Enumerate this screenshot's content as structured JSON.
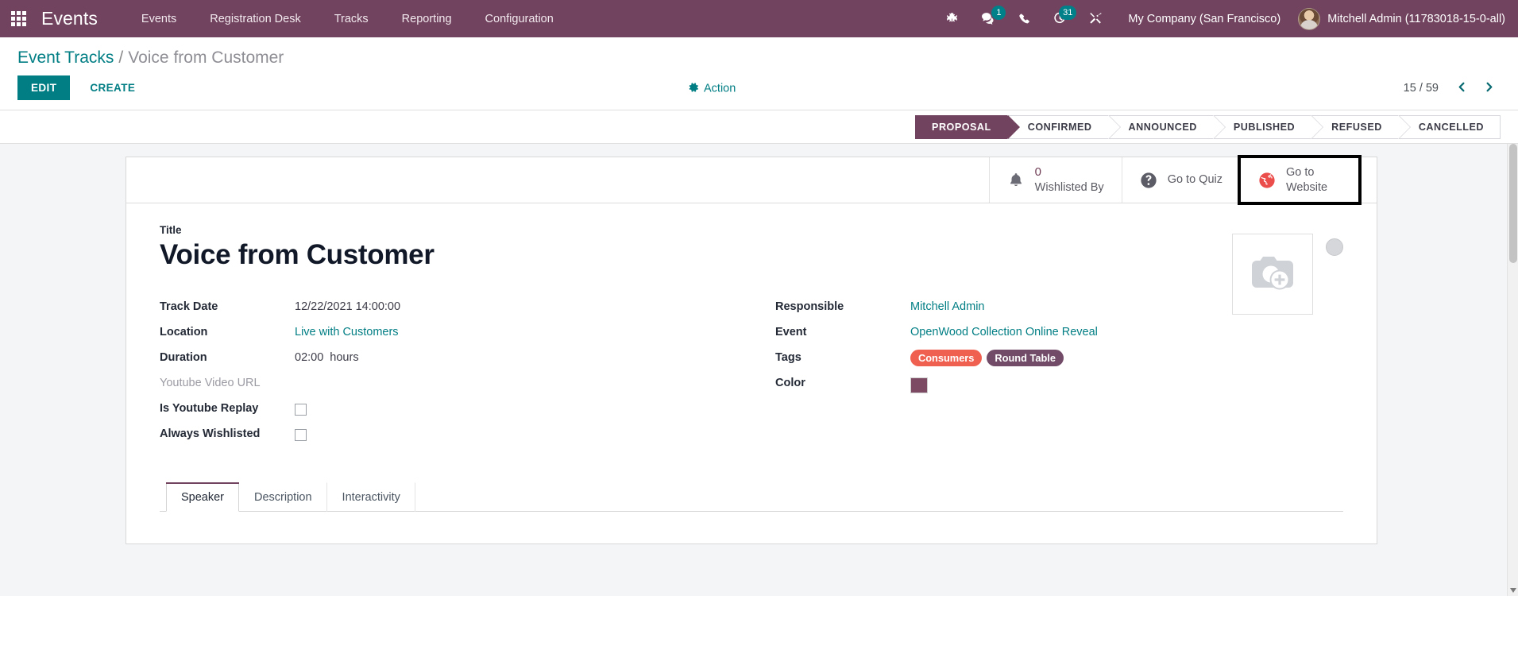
{
  "navbar": {
    "apps_icon": "apps-grid-icon",
    "brand": "Events",
    "menu": [
      {
        "label": "Events"
      },
      {
        "label": "Registration Desk"
      },
      {
        "label": "Tracks"
      },
      {
        "label": "Reporting"
      },
      {
        "label": "Configuration"
      }
    ],
    "sys_icons": [
      {
        "name": "bug-icon",
        "badge": null
      },
      {
        "name": "messages-icon",
        "badge": "1"
      },
      {
        "name": "phone-icon",
        "badge": null
      },
      {
        "name": "activities-clock-icon",
        "badge": "31"
      },
      {
        "name": "tools-icon",
        "badge": null
      }
    ],
    "company": "My Company (San Francisco)",
    "user": "Mitchell Admin (11783018-15-0-all)",
    "bg_color": "#71435f"
  },
  "control_panel": {
    "breadcrumb_root": "Event Tracks",
    "breadcrumb_sep": "/",
    "breadcrumb_current": "Voice from Customer",
    "edit_label": "EDIT",
    "create_label": "CREATE",
    "action_label": "Action",
    "pager_text": "15 / 59",
    "accent_color": "#017e84"
  },
  "statusbar": {
    "stages": [
      {
        "label": "PROPOSAL",
        "active": true
      },
      {
        "label": "CONFIRMED",
        "active": false
      },
      {
        "label": "ANNOUNCED",
        "active": false
      },
      {
        "label": "PUBLISHED",
        "active": false
      },
      {
        "label": "REFUSED",
        "active": false
      },
      {
        "label": "CANCELLED",
        "active": false
      }
    ],
    "active_color": "#71435f"
  },
  "stat_buttons": [
    {
      "icon": "bell-icon",
      "value": "0",
      "label": "Wishlisted By",
      "highlighted": false
    },
    {
      "icon": "question-circle-icon",
      "value": "",
      "label": "Go to Quiz",
      "highlighted": false
    },
    {
      "icon": "globe-icon",
      "value": "",
      "label": "Go to Website",
      "highlighted": true
    }
  ],
  "form": {
    "title_label": "Title",
    "title_value": "Voice from Customer",
    "image_placeholder_icon": "camera-add-icon",
    "left_fields": [
      {
        "label": "Track Date",
        "value": "12/22/2021 14:00:00",
        "type": "text"
      },
      {
        "label": "Location",
        "value": "Live with Customers",
        "type": "link"
      },
      {
        "label": "Duration",
        "value": "02:00",
        "unit": "hours",
        "type": "text-unit"
      },
      {
        "label": "Youtube Video URL",
        "value": "",
        "type": "empty"
      },
      {
        "label": "Is Youtube Replay",
        "value": "",
        "type": "checkbox",
        "checked": false
      },
      {
        "label": "Always Wishlisted",
        "value": "",
        "type": "checkbox",
        "checked": false
      }
    ],
    "right_fields": [
      {
        "label": "Responsible",
        "value": "Mitchell Admin",
        "type": "link"
      },
      {
        "label": "Event",
        "value": "OpenWood Collection Online Reveal",
        "type": "link"
      },
      {
        "label": "Tags",
        "type": "tags",
        "tags": [
          {
            "text": "Consumers",
            "color": "#f06050"
          },
          {
            "text": "Round Table",
            "color": "#714b67"
          }
        ]
      },
      {
        "label": "Color",
        "type": "color",
        "color": "#7d4a63"
      }
    ],
    "tabs": [
      {
        "label": "Speaker",
        "active": true
      },
      {
        "label": "Description",
        "active": false
      },
      {
        "label": "Interactivity",
        "active": false
      }
    ]
  }
}
